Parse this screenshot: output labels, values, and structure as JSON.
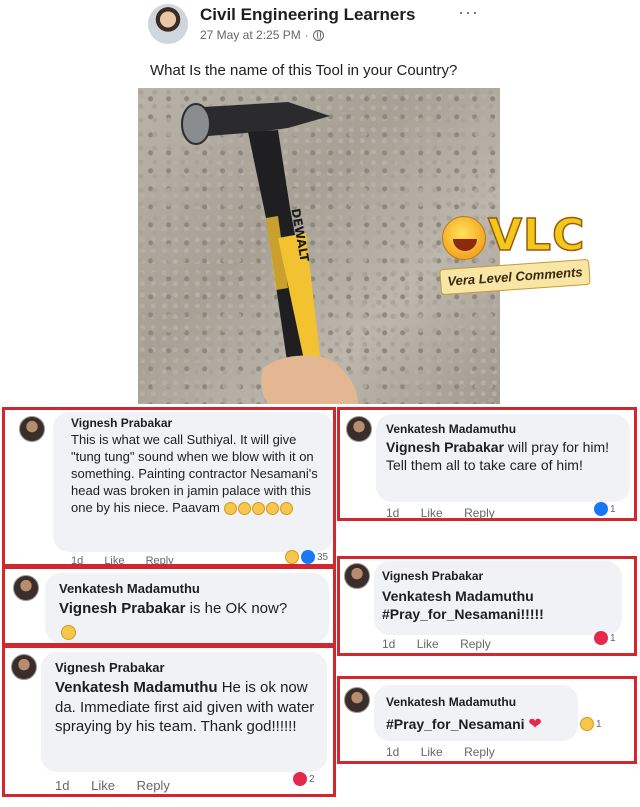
{
  "post": {
    "page_name": "Civil Engineering Learners",
    "timestamp": "27 May at 2:25 PM",
    "separator": "·",
    "more": "···",
    "text": "What Is the name of this Tool in your Country?"
  },
  "photo": {
    "brand": "DEWALT"
  },
  "watermark": {
    "letters": "VLC",
    "tagline": "Vera Level Comments"
  },
  "comments": [
    {
      "author": "Vignesh Prabakar",
      "text": "This is what we call Suthiyal. It will give \"tung tung\" sound when we blow with it on something. Painting contractor Nesamani's head was broken in jamin palace with this one by his niece. Paavam",
      "emoji_count": 5,
      "time": "1d",
      "like": "Like",
      "reply": "Reply",
      "reactions": "35"
    },
    {
      "author": "Venkatesh Madamuthu",
      "mention": "Vignesh Prabakar",
      "text": "will pray for him! Tell them all to take care of him!",
      "time": "1d",
      "like": "Like",
      "reply": "Reply",
      "reactions": "1"
    },
    {
      "author": "Venkatesh Madamuthu",
      "mention": "Vignesh Prabakar",
      "text": "is he OK now?",
      "time": "",
      "like": "",
      "reply": ""
    },
    {
      "author": "Vignesh Prabakar",
      "mention": "Venkatesh Madamuthu",
      "text": "#Pray_for_Nesamani!!!!!",
      "time": "1d",
      "like": "Like",
      "reply": "Reply",
      "reactions": "1"
    },
    {
      "author": "Vignesh Prabakar",
      "mention": "Venkatesh Madamuthu",
      "text": "He is ok now da.  Immediate first aid given with water spraying by his team. Thank god!!!!!!",
      "time": "1d",
      "like": "Like",
      "reply": "Reply",
      "reactions": "2"
    },
    {
      "author": "Venkatesh Madamuthu",
      "text": "#Pray_for_Nesamani",
      "time": "1d",
      "like": "Like",
      "reply": "Reply",
      "reactions": "1"
    }
  ],
  "colors": {
    "highlight_border": "#d0282e",
    "bubble": "#f0f2f5",
    "like_blue": "#1877f2",
    "love_red": "#e4294c"
  }
}
